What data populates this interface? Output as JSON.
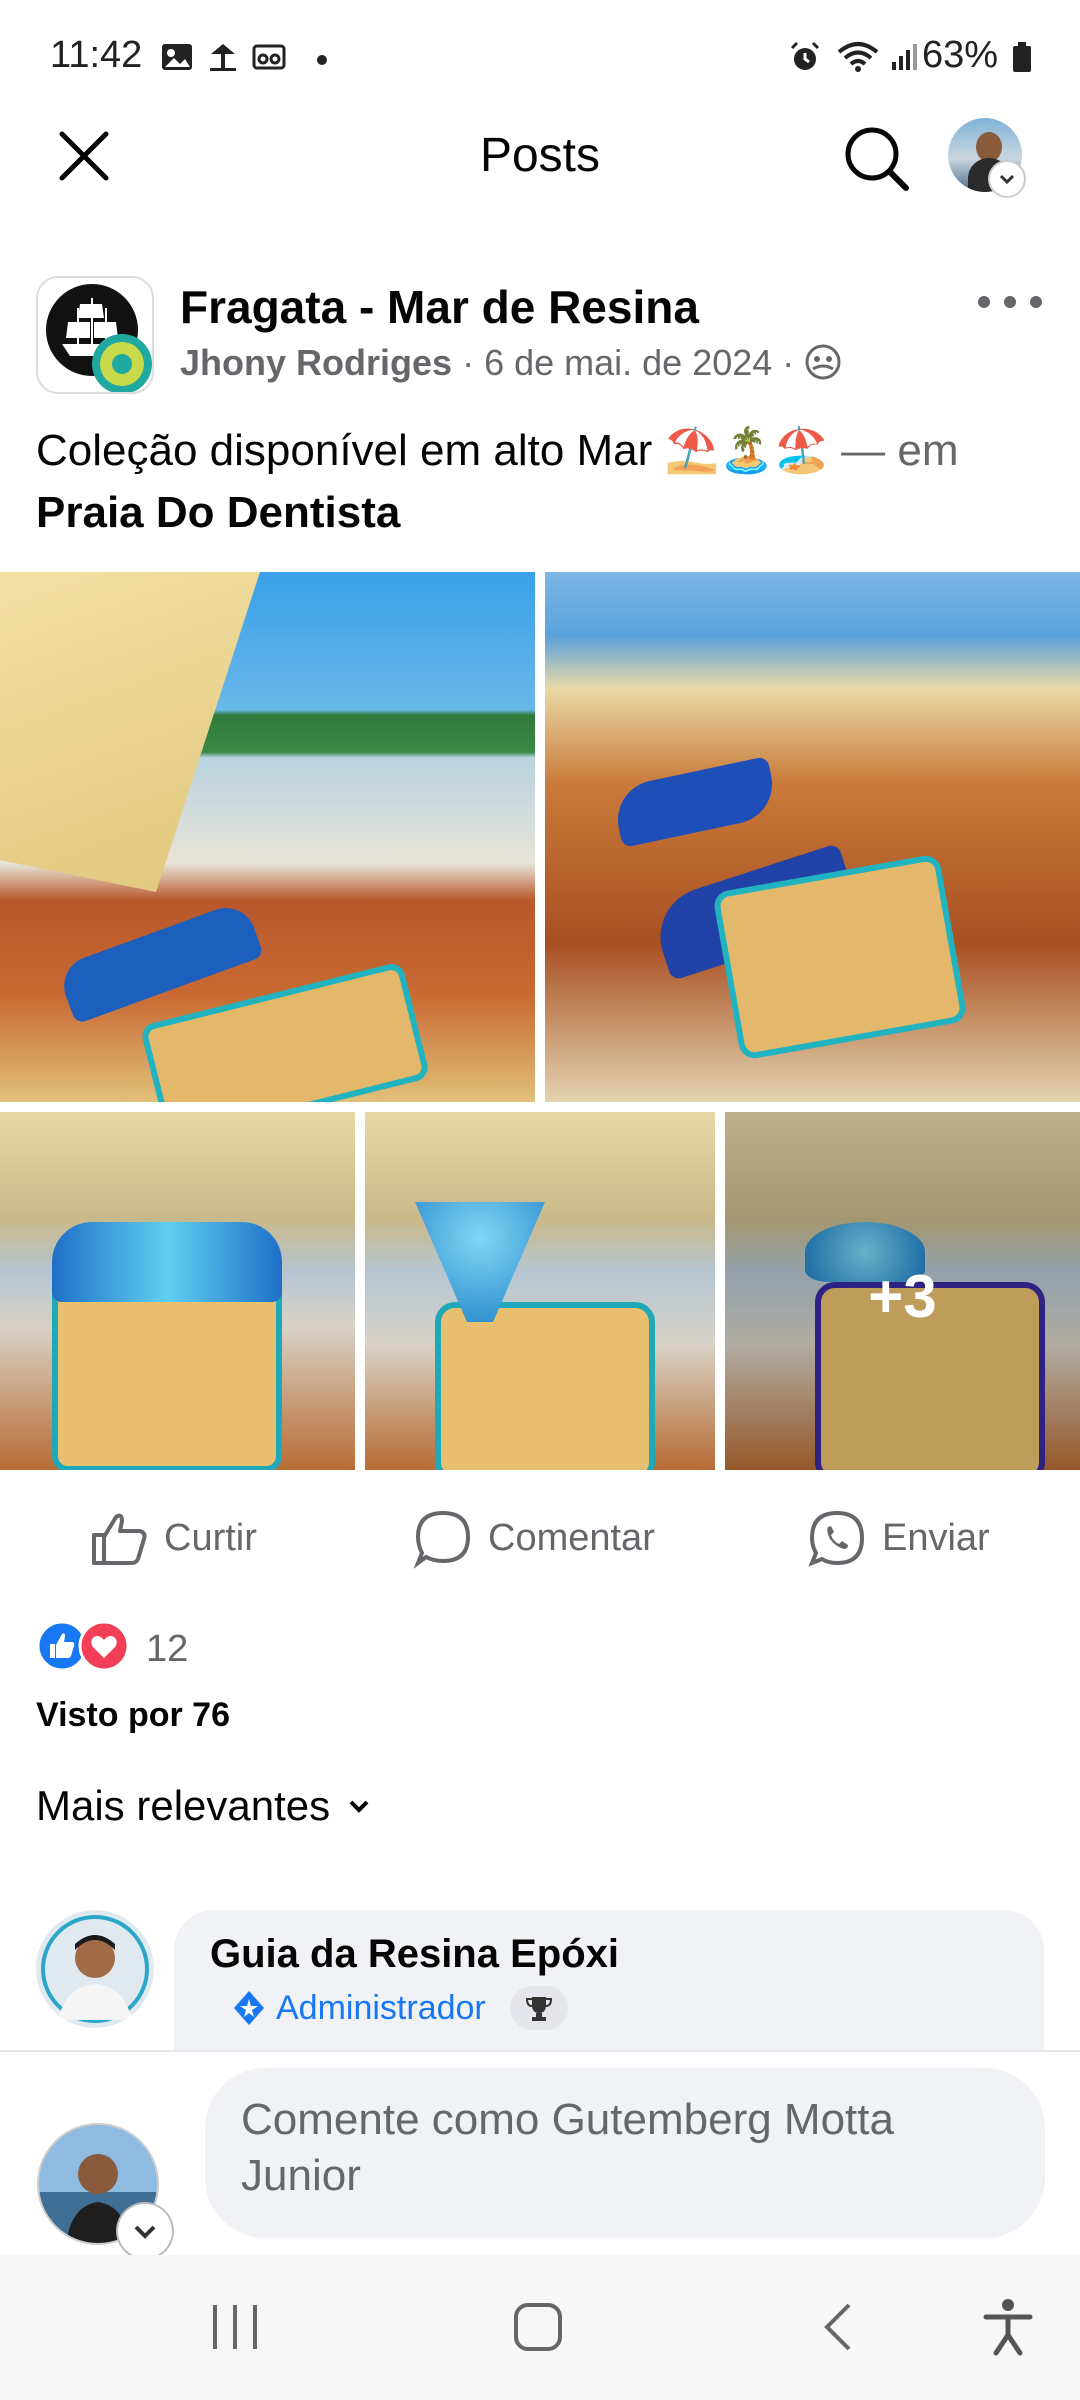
{
  "status_bar": {
    "time": "11:42",
    "battery": "63%"
  },
  "top_bar": {
    "title": "Posts",
    "close_icon": "close-icon",
    "search_icon": "search-icon"
  },
  "post": {
    "group_name": "Fragata - Mar de Resina",
    "author": "Jhony Rodriges",
    "date": "6 de mai. de 2024",
    "caption_text": "Coleção disponível em alto Mar",
    "caption_emojis": "⛱️🏝️🏖️",
    "caption_em": "— em",
    "location": "Praia Do  Dentista",
    "more_photos": "+3"
  },
  "actions": {
    "like": "Curtir",
    "comment": "Comentar",
    "send": "Enviar"
  },
  "reactions": {
    "count": "12",
    "seen_by": "Visto por 76"
  },
  "comments": {
    "sort_label": "Mais relevantes",
    "items": [
      {
        "author": "Guia da Resina Epóxi",
        "badge": "Administrador"
      }
    ]
  },
  "composer": {
    "placeholder": "Comente como Gutemberg Motta Junior"
  },
  "colors": {
    "accent": "#1877f2",
    "secondary_text": "#65676b",
    "bubble": "#f0f2f5"
  }
}
